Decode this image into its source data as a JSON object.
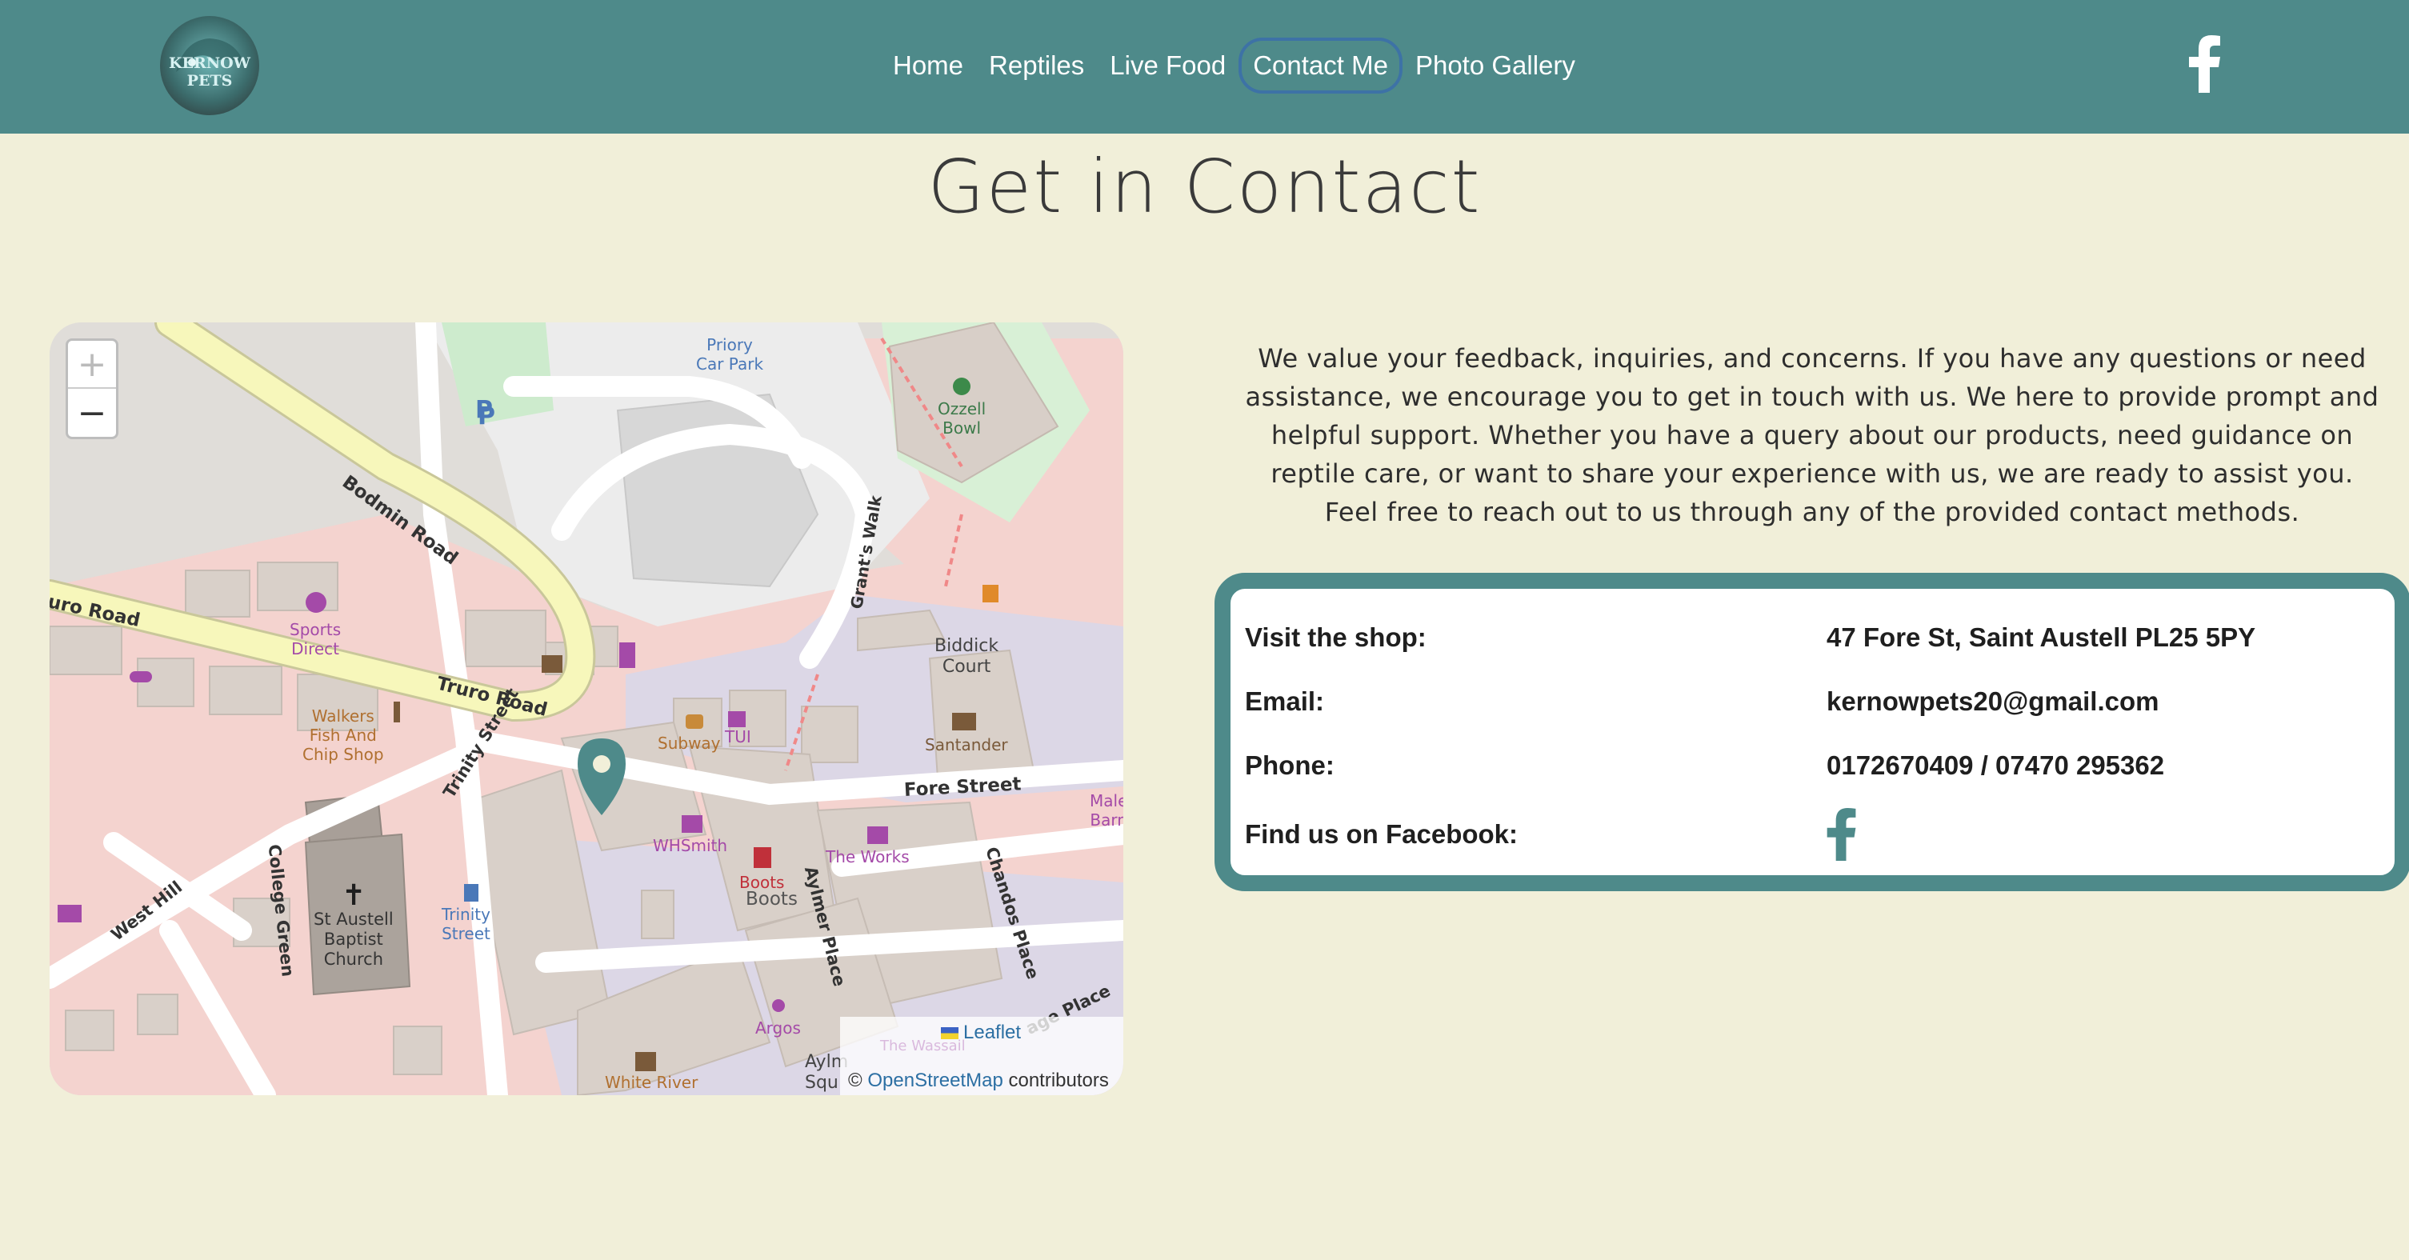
{
  "nav": {
    "logo_text": "KERNOW PETS",
    "links": [
      "Home",
      "Reptiles",
      "Live Food",
      "Contact Me",
      "Photo Gallery"
    ],
    "active_link": "Contact Me",
    "facebook_icon": "facebook-icon",
    "background_color": "#4e8a8a"
  },
  "page_title": "Get in Contact",
  "intro": "We value your feedback, inquiries, and concerns. If you have any questions or need assistance, we encourage you to get in touch with us. We here to provide prompt and helpful support. Whether you have a query about our products, need guidance on reptile care, or want to share your experience with us, we are ready to assist you. Feel free to reach out to us through any of the provided contact methods.",
  "map": {
    "zoom_in": "+",
    "zoom_out": "−",
    "labels": {
      "priory_car_park": "Priory\nCar Park",
      "ozzell_bowl": "Ozzell\nBowl",
      "bodmin_road": "Bodmin Road",
      "truro_road_left": "uro Road",
      "truro_road": "Truro Road",
      "sports_direct": "Sports\nDirect",
      "grants_walk": "Grant's Walk",
      "biddick_court": "Biddick\nCourt",
      "walkers": "Walkers\nFish And\nChip Shop",
      "subway": "Subway",
      "tui": "TUI",
      "santander": "Santander",
      "trinity_street": "Trinity Street",
      "fore_street": "Fore Street",
      "male_barn": "Male\nBarn",
      "whsmith": "WHSmith",
      "the_works": "The Works",
      "boots_pink": "Boots",
      "boots": "Boots",
      "aylmer_place": "Aylmer Place",
      "chandos_place": "Chandos Place",
      "college_green": "College Green",
      "west_hill": "West Hill",
      "church": "St Austell\nBaptist\nChurch",
      "trinity_stop": "Trinity\nStreet",
      "argos": "Argos",
      "white_river": "White River",
      "aylmer_square": "Aylm\nSqu",
      "the_wassail": "The Wassail",
      "vicarage_place": "age Place",
      "parking": "P"
    },
    "attribution_leaflet": "Leaflet",
    "attribution_prefix": "©",
    "attribution_osm": "OpenStreetMap",
    "attribution_suffix": "contributors"
  },
  "contact": {
    "rows": [
      {
        "label": "Visit the shop:",
        "value": "47 Fore St, Saint Austell PL25 5PY"
      },
      {
        "label": "Email:",
        "value": "kernowpets20@gmail.com"
      },
      {
        "label": "Phone:",
        "value": "0172670409 / 07470 295362"
      },
      {
        "label": "Find us on Facebook:",
        "value": ""
      }
    ],
    "facebook_icon": "facebook-icon",
    "border_color": "#4e8a8a"
  }
}
